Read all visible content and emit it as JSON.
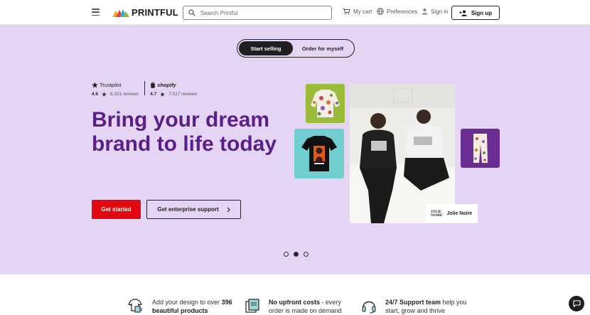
{
  "header": {
    "logo_text": "PRINTFUL",
    "search_placeholder": "Search Printful",
    "cart_label": "My cart",
    "preferences_label": "Preferences",
    "signin_label": "Sign in",
    "signup_label": "Sign up"
  },
  "hero": {
    "toggle": [
      "Start selling",
      "Order for myself"
    ],
    "trustpilot": {
      "brand": "Trustpilot",
      "score": "4.6",
      "reviews": "6,321 reviews"
    },
    "shopify": {
      "brand": "shopify",
      "score": "4.7",
      "reviews": "7,517 reviews"
    },
    "headline": "Bring your dream brand to life today",
    "primary_cta": "Get started",
    "secondary_cta": "Get enterprise support",
    "brand_card": {
      "logo_line1": "JOLIE",
      "logo_line2": "NOIRE",
      "name": "Jolie Noire"
    },
    "carousel": {
      "count": 3,
      "active": 1
    }
  },
  "features": [
    {
      "pre": "Add your design to over ",
      "bold": "396",
      "line2_bold": "beautiful products",
      "line2": ""
    },
    {
      "bold": "No upfront costs",
      "rest": " - every",
      "line2": "order is made on demand"
    },
    {
      "bold": "24/7 Support team",
      "rest": " help you",
      "line2": "start, grow and thrive"
    }
  ],
  "colors": {
    "hero_bg": "#e5d5f5",
    "headline": "#5b1f8a",
    "primary": "#e1060f"
  }
}
